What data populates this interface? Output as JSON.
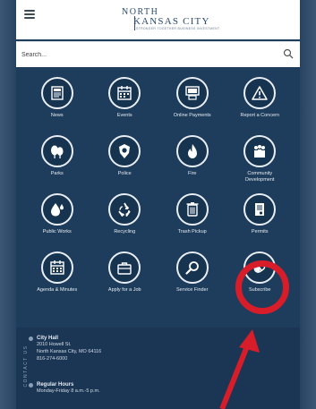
{
  "header": {
    "logo_top": "NORTH",
    "logo_main": "KANSAS CITY",
    "logo_sub": "STRONGER TOGETHER BUSINESS INVESTMENT",
    "menu_icon": "hamburger-menu-icon"
  },
  "search": {
    "placeholder": "Search...",
    "icon": "search-icon"
  },
  "tiles": [
    {
      "label": "News",
      "icon": "newspaper-icon"
    },
    {
      "label": "Events",
      "icon": "calendar-icon"
    },
    {
      "label": "Online Payments",
      "icon": "payment-terminal-icon"
    },
    {
      "label": "Report a Concern",
      "icon": "warning-icon"
    },
    {
      "label": "Parks",
      "icon": "trees-icon"
    },
    {
      "label": "Police",
      "icon": "police-badge-icon"
    },
    {
      "label": "Fire",
      "icon": "flame-icon"
    },
    {
      "label": "Community Development",
      "icon": "community-icon"
    },
    {
      "label": "Public Works",
      "icon": "water-drop-icon"
    },
    {
      "label": "Recycling",
      "icon": "recycle-icon"
    },
    {
      "label": "Trash Pickup",
      "icon": "trash-can-icon"
    },
    {
      "label": "Permits",
      "icon": "permit-document-icon"
    },
    {
      "label": "Agenda & Minutes",
      "icon": "calendar-agenda-icon"
    },
    {
      "label": "Apply for a Job",
      "icon": "briefcase-icon"
    },
    {
      "label": "Service Finder",
      "icon": "magnifier-icon"
    },
    {
      "label": "Subscribe",
      "icon": "subscribe-icon"
    }
  ],
  "footer": {
    "side_label": "CONTACT US",
    "city_hall_title": "City Hall",
    "city_hall_address1": "2010 Howell St.",
    "city_hall_address2": "North Kansas City, MO 64116",
    "city_hall_phone": "816-274-6000",
    "hours_title": "Regular Hours",
    "hours_line": "Monday-Friday 8 a.m.-5 p.m."
  },
  "annotation": {
    "ring_color": "#d71d2a",
    "arrow_color": "#d71d2a"
  }
}
